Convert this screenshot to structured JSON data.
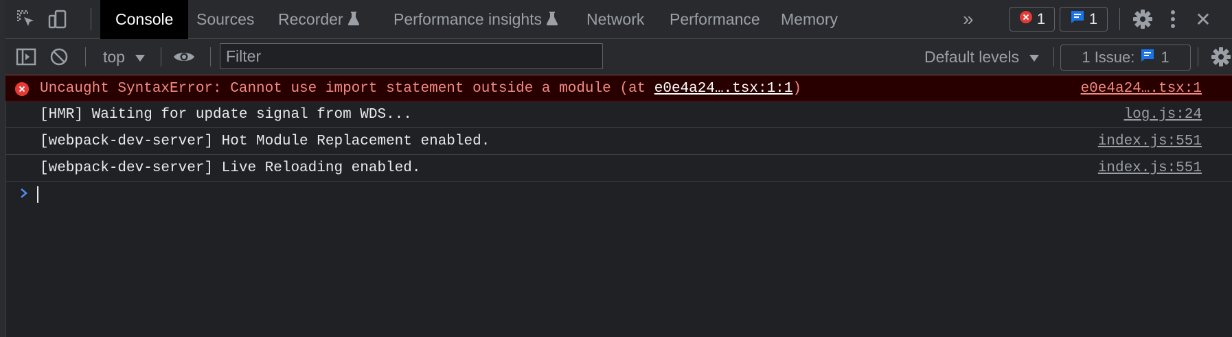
{
  "tabs": [
    {
      "label": "Console",
      "active": true
    },
    {
      "label": "Sources"
    },
    {
      "label": "Recorder",
      "icon": "flask-icon"
    },
    {
      "label": "Performance insights",
      "icon": "flask-icon"
    },
    {
      "label": "Network"
    },
    {
      "label": "Performance"
    },
    {
      "label": "Memory"
    }
  ],
  "toolbar": {
    "more_tabs": "»",
    "error_count": "1",
    "message_count": "1",
    "close": "✕"
  },
  "filterbar": {
    "context": "top",
    "filter_placeholder": "Filter",
    "levels": "Default levels",
    "issues_label": "1 Issue:",
    "issues_count": "1"
  },
  "messages": [
    {
      "level": "error",
      "text_before": "Uncaught SyntaxError: Cannot use import statement outside a module (at ",
      "link": "e0e4a24….tsx:1:1",
      "text_after": ")",
      "source": "e0e4a24….tsx:1"
    },
    {
      "level": "log",
      "text": "[HMR] Waiting for update signal from WDS...",
      "source": "log.js:24"
    },
    {
      "level": "log",
      "text": "[webpack-dev-server] Hot Module Replacement enabled.",
      "source": "index.js:551"
    },
    {
      "level": "log",
      "text": "[webpack-dev-server] Live Reloading enabled.",
      "source": "index.js:551"
    }
  ],
  "colors": {
    "background": "#202124",
    "error_text": "#f28b82",
    "error_background": "#290000",
    "accent_blue": "#1a73e8"
  }
}
